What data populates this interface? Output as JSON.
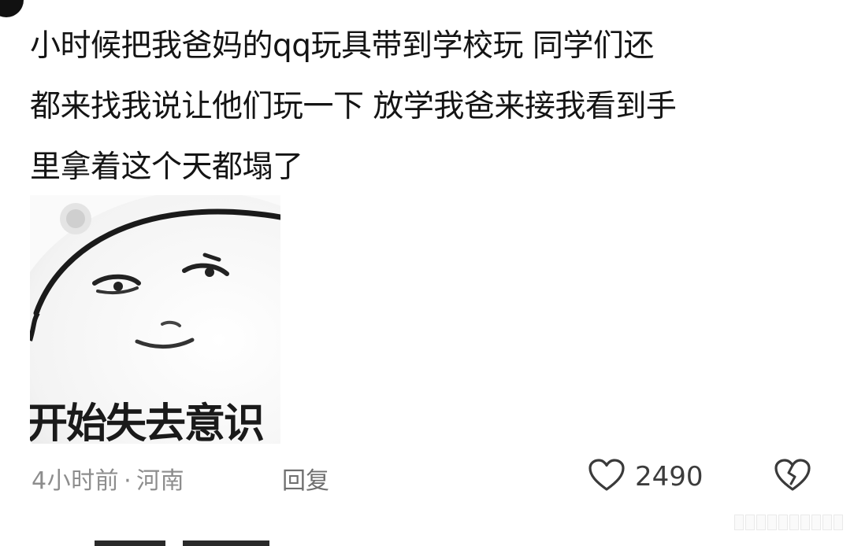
{
  "comment": {
    "lines": [
      "小时候把我爸妈的qq玩具带到学校玩 同学们还",
      "都来找我说让他们玩一下 放学我爸来接我看到手",
      "里拿着这个天都塌了"
    ],
    "meme": {
      "caption": "开始失去意识",
      "icon": "dazed-face-meme"
    },
    "meta": {
      "time": "4小时前",
      "separator": "·",
      "location": "河南",
      "reply_label": "回复"
    },
    "likes": {
      "count": "2490",
      "icon": "heart-outline-icon"
    },
    "dislike": {
      "icon": "broken-heart-icon"
    }
  }
}
